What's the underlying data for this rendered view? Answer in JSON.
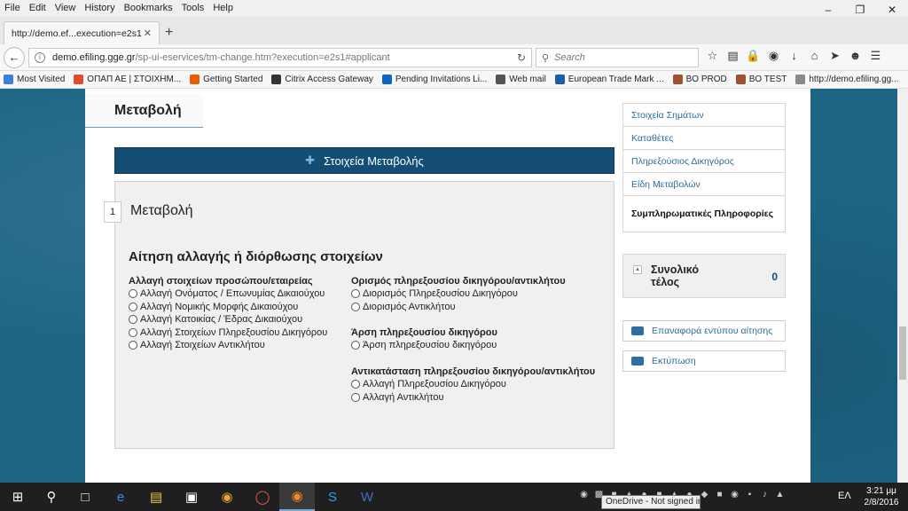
{
  "menu": [
    "File",
    "Edit",
    "View",
    "History",
    "Bookmarks",
    "Tools",
    "Help"
  ],
  "window_controls": [
    "–",
    "❐",
    "✕"
  ],
  "tab": {
    "title": "http://demo.ef...execution=e2s1",
    "close": "✕"
  },
  "new_tab": "+",
  "url": {
    "host": "demo.efiling.gge.gr",
    "path": "/sp-ui-eservices/tm-change.htm?execution=e2s1#applicant"
  },
  "search": {
    "placeholder": "Search"
  },
  "bookmarks": [
    {
      "label": "Most Visited",
      "color": "#3d7ee0"
    },
    {
      "label": "ΟΠΑΠ ΑΕ | ΣΤΟΙΧΗΜ...",
      "color": "#e04a2f"
    },
    {
      "label": "Getting Started",
      "color": "#e66000"
    },
    {
      "label": "Citrix Access Gateway",
      "color": "#333333"
    },
    {
      "label": "Pending Invitations Li...",
      "color": "#0a66c2"
    },
    {
      "label": "Web mail",
      "color": "#555555"
    },
    {
      "label": "European Trade Mark ...",
      "color": "#1e5ba8"
    },
    {
      "label": "BO PROD",
      "color": "#a0522d"
    },
    {
      "label": "BO TEST",
      "color": "#a0522d"
    },
    {
      "label": "http://demo.efiling.gg...",
      "color": "#888888"
    }
  ],
  "page": {
    "section_title": "Μεταβολή",
    "banner": "Στοιχεία Μεταβολής",
    "step_number": "1",
    "step_name": "Μεταβολή",
    "form_title": "Αίτηση αλλαγής ή διόρθωσης στοιχείων",
    "groups": {
      "left": {
        "heading": "Αλλαγή στοιχείων προσώπου/εταιρείας",
        "options": [
          "Αλλαγή Ονόματος / Επωνυμίας Δικαιούχου",
          "Αλλαγή Νομικής Μορφής Δικαιούχου",
          "Αλλαγή Κατοικίας / Έδρας Δικαιούχου",
          "Αλλαγή Στοιχείων Πληρεξουσίου Δικηγόρου",
          "Αλλαγή Στοιχείων Αντικλήτου"
        ]
      },
      "appoint": {
        "heading": "Ορισμός πληρεξουσίου δικηγόρου/αντικλήτου",
        "options": [
          "Διορισμός Πληρεξουσίου Δικηγόρου",
          "Διορισμός Αντικλήτου"
        ]
      },
      "revoke": {
        "heading": "Άρση πληρεξουσίου δικηγόρου",
        "options": [
          "Άρση πληρεξουσίου δικηγόρου"
        ]
      },
      "replace": {
        "heading": "Αντικατάσταση πληρεξουσίου δικηγόρου/αντικλήτου",
        "options": [
          "Αλλαγή Πληρεξουσίου Δικηγόρου",
          "Αλλαγή Αντικλήτου"
        ]
      }
    },
    "sidenav": [
      "Στοιχεία Σημάτων",
      "Καταθέτες",
      "Πληρεξούσιος Δικηγόρος",
      "Είδη Μεταβολών",
      "Συμπληρωματικές Πληροφορίες"
    ],
    "total": {
      "label": "Συνολικό τέλος",
      "value": "0"
    },
    "reset_label": "Επαναφορά εντύπου αίτησης",
    "print_label": "Εκτύπωση"
  },
  "taskbar": {
    "language": "ΕΛ",
    "time": "3:21 μμ",
    "date": "2/8/2016",
    "tooltip": "OneDrive - Not signed in"
  }
}
